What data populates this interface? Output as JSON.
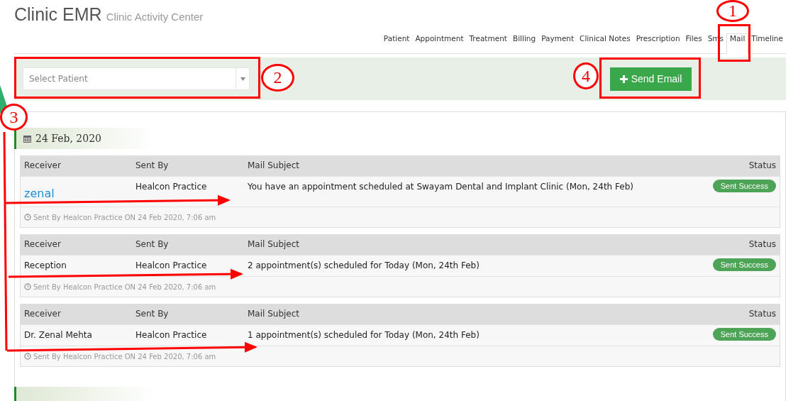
{
  "header": {
    "title": "Clinic EMR",
    "subtitle": "Clinic Activity Center"
  },
  "tabs": [
    {
      "label": "Patient",
      "selected": false
    },
    {
      "label": "Appointment",
      "selected": false
    },
    {
      "label": "Treatment",
      "selected": false
    },
    {
      "label": "Billing",
      "selected": false
    },
    {
      "label": "Payment",
      "selected": false
    },
    {
      "label": "Clinical Notes",
      "selected": false
    },
    {
      "label": "Prescription",
      "selected": false
    },
    {
      "label": "Files",
      "selected": false
    },
    {
      "label": "Sms",
      "selected": false
    },
    {
      "label": "Mail",
      "selected": true
    },
    {
      "label": "Timeline",
      "selected": false
    }
  ],
  "toolbar": {
    "patient_select": {
      "placeholder": "Select Patient"
    },
    "send_button": {
      "label": "Send Email"
    }
  },
  "days": [
    {
      "date": "24 Feb, 2020",
      "mails": [
        {
          "columns": [
            "Receiver",
            "Sent By",
            "Mail Subject",
            "Status"
          ],
          "receiver": "zenal",
          "receiver_link": true,
          "sent_by": "Healcon Practice",
          "subject": "You have an appointment scheduled at Swayam Dental and Implant Clinic (Mon, 24th Feb)",
          "status": "Sent Success",
          "footer": "Sent By Healcon Practice ON 24 Feb 2020, 7:06 am"
        },
        {
          "columns": [
            "Receiver",
            "Sent By",
            "Mail Subject",
            "Status"
          ],
          "receiver": "Reception",
          "receiver_link": false,
          "sent_by": "Healcon Practice",
          "subject": "2 appointment(s) scheduled for Today (Mon, 24th Feb)",
          "status": "Sent Success",
          "footer": "Sent By Healcon Practice ON 24 Feb 2020, 7:06 am"
        },
        {
          "columns": [
            "Receiver",
            "Sent By",
            "Mail Subject",
            "Status"
          ],
          "receiver": "Dr. Zenal Mehta",
          "receiver_link": false,
          "sent_by": "Healcon Practice",
          "subject": "1 appointment(s) scheduled for Today (Mon, 24th Feb)",
          "status": "Sent Success",
          "footer": "Sent By Healcon Practice ON 24 Feb 2020, 7:06 am"
        }
      ]
    }
  ],
  "annotations": [
    {
      "label": "1"
    },
    {
      "label": "2"
    },
    {
      "label": "3"
    },
    {
      "label": "4"
    }
  ]
}
